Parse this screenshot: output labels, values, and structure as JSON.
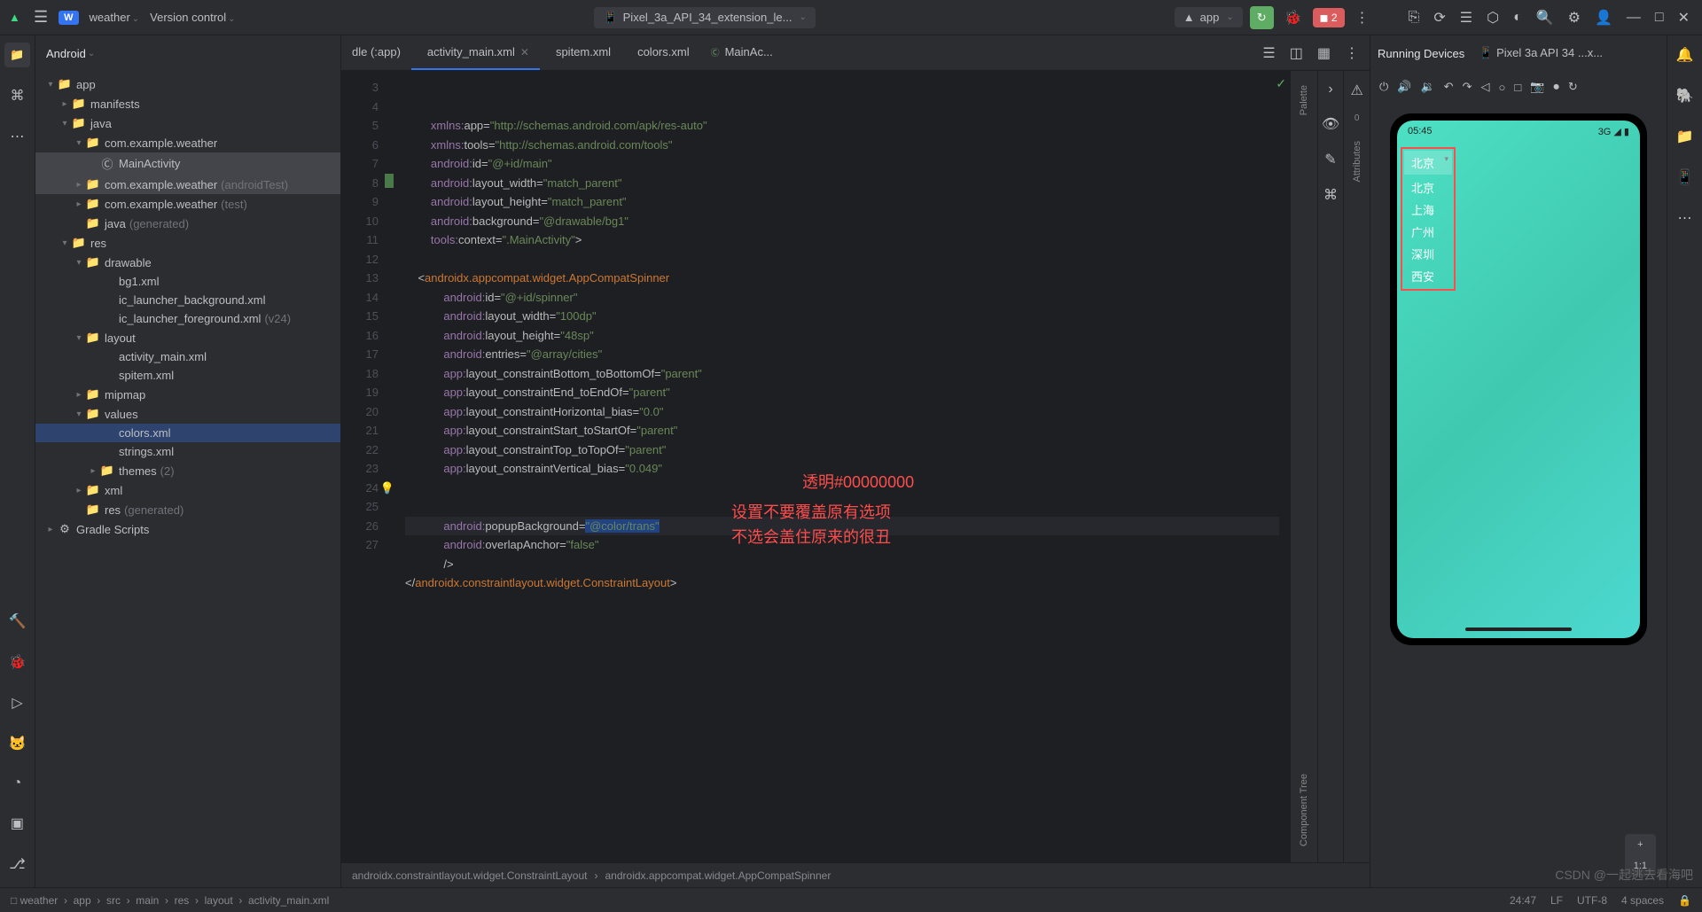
{
  "topBar": {
    "projectBadge": "W",
    "projectName": "weather",
    "versionControl": "Version control",
    "deviceConfig": "Pixel_3a_API_34_extension_le...",
    "runConfig": "app",
    "stopCount": "2"
  },
  "projectPanel": {
    "title": "Android",
    "tree": [
      {
        "indent": 0,
        "arrow": "▾",
        "icon": "📁",
        "label": "app",
        "cls": ""
      },
      {
        "indent": 1,
        "arrow": "▸",
        "icon": "📁",
        "label": "manifests",
        "cls": ""
      },
      {
        "indent": 1,
        "arrow": "▾",
        "icon": "📁",
        "label": "java",
        "cls": ""
      },
      {
        "indent": 2,
        "arrow": "▾",
        "icon": "📁",
        "label": "com.example.weather",
        "cls": ""
      },
      {
        "indent": 3,
        "arrow": "",
        "icon": "Ⓒ",
        "label": "MainActivity",
        "cls": "highlight"
      },
      {
        "indent": 2,
        "arrow": "▸",
        "icon": "📁",
        "label": "com.example.weather",
        "hint": "(androidTest)",
        "cls": "highlight"
      },
      {
        "indent": 2,
        "arrow": "▸",
        "icon": "📁",
        "label": "com.example.weather",
        "hint": "(test)",
        "cls": ""
      },
      {
        "indent": 2,
        "arrow": "",
        "icon": "📁",
        "label": "java",
        "hint": "(generated)",
        "cls": ""
      },
      {
        "indent": 1,
        "arrow": "▾",
        "icon": "📁",
        "label": "res",
        "cls": ""
      },
      {
        "indent": 2,
        "arrow": "▾",
        "icon": "📁",
        "label": "drawable",
        "cls": ""
      },
      {
        "indent": 3,
        "arrow": "",
        "icon": "</>",
        "label": "bg1.xml",
        "cls": ""
      },
      {
        "indent": 3,
        "arrow": "",
        "icon": "</>",
        "label": "ic_launcher_background.xml",
        "cls": ""
      },
      {
        "indent": 3,
        "arrow": "",
        "icon": "</>",
        "label": "ic_launcher_foreground.xml",
        "hint": "(v24)",
        "cls": ""
      },
      {
        "indent": 2,
        "arrow": "▾",
        "icon": "📁",
        "label": "layout",
        "cls": ""
      },
      {
        "indent": 3,
        "arrow": "",
        "icon": "</>",
        "label": "activity_main.xml",
        "cls": ""
      },
      {
        "indent": 3,
        "arrow": "",
        "icon": "</>",
        "label": "spitem.xml",
        "cls": ""
      },
      {
        "indent": 2,
        "arrow": "▸",
        "icon": "📁",
        "label": "mipmap",
        "cls": ""
      },
      {
        "indent": 2,
        "arrow": "▾",
        "icon": "📁",
        "label": "values",
        "cls": ""
      },
      {
        "indent": 3,
        "arrow": "",
        "icon": "</>",
        "label": "colors.xml",
        "cls": "selected"
      },
      {
        "indent": 3,
        "arrow": "",
        "icon": "</>",
        "label": "strings.xml",
        "cls": ""
      },
      {
        "indent": 3,
        "arrow": "▸",
        "icon": "📁",
        "label": "themes",
        "hint": "(2)",
        "cls": ""
      },
      {
        "indent": 2,
        "arrow": "▸",
        "icon": "📁",
        "label": "xml",
        "cls": ""
      },
      {
        "indent": 2,
        "arrow": "",
        "icon": "📁",
        "label": "res",
        "hint": "(generated)",
        "cls": ""
      },
      {
        "indent": 0,
        "arrow": "▸",
        "icon": "⚙",
        "label": "Gradle Scripts",
        "cls": ""
      }
    ]
  },
  "tabs": [
    {
      "icon": "",
      "label": "dle (:app)",
      "active": false,
      "close": false
    },
    {
      "icon": "</>",
      "label": "activity_main.xml",
      "active": true,
      "close": true
    },
    {
      "icon": "</>",
      "label": "spitem.xml",
      "active": false,
      "close": false
    },
    {
      "icon": "</>",
      "label": "colors.xml",
      "active": false,
      "close": false
    },
    {
      "icon": "Ⓒ",
      "label": "MainAc...",
      "active": false,
      "close": false
    }
  ],
  "code": {
    "startLine": 3,
    "lines": [
      "        <span class='c-ns'>xmlns:</span><span class='c-attr'>app</span>=<span class='c-str'>\"http://schemas.android.com/apk/res-auto\"</span>",
      "        <span class='c-ns'>xmlns:</span><span class='c-attr'>tools</span>=<span class='c-str'>\"http://schemas.android.com/tools\"</span>",
      "        <span class='c-ns'>android:</span><span class='c-attr'>id</span>=<span class='c-str'>\"@+id/main\"</span>",
      "        <span class='c-ns'>android:</span><span class='c-attr'>layout_width</span>=<span class='c-str'>\"match_parent\"</span>",
      "        <span class='c-ns'>android:</span><span class='c-attr'>layout_height</span>=<span class='c-str'>\"match_parent\"</span>",
      "        <span class='c-ns'>android:</span><span class='c-attr'>background</span>=<span class='c-str'>\"@drawable/bg1\"</span>",
      "        <span class='c-ns'>tools:</span><span class='c-attr'>context</span>=<span class='c-str'>\".MainActivity\"</span>&gt;",
      "",
      "    &lt;<span class='c-tag'>androidx.appcompat.widget.AppCompatSpinner</span>",
      "            <span class='c-ns'>android:</span><span class='c-attr'>id</span>=<span class='c-str'>\"@+id/spinner\"</span>",
      "            <span class='c-ns'>android:</span><span class='c-attr'>layout_width</span>=<span class='c-str'>\"100dp\"</span>",
      "            <span class='c-ns'>android:</span><span class='c-attr'>layout_height</span>=<span class='c-str'>\"48sp\"</span>",
      "            <span class='c-ns'>android:</span><span class='c-attr'>entries</span>=<span class='c-str'>\"@array/cities\"</span>",
      "            <span class='c-ns'>app:</span><span class='c-attr'>layout_constraintBottom_toBottomOf</span>=<span class='c-str'>\"parent\"</span>",
      "            <span class='c-ns'>app:</span><span class='c-attr'>layout_constraintEnd_toEndOf</span>=<span class='c-str'>\"parent\"</span>",
      "            <span class='c-ns'>app:</span><span class='c-attr'>layout_constraintHorizontal_bias</span>=<span class='c-str'>\"0.0\"</span>",
      "            <span class='c-ns'>app:</span><span class='c-attr'>layout_constraintStart_toStartOf</span>=<span class='c-str'>\"parent\"</span>",
      "            <span class='c-ns'>app:</span><span class='c-attr'>layout_constraintTop_toTopOf</span>=<span class='c-str'>\"parent\"</span>",
      "            <span class='c-ns'>app:</span><span class='c-attr'>layout_constraintVertical_bias</span>=<span class='c-str'>\"0.049\"</span>",
      "",
      "",
      "            <span class='c-ns'>android:</span><span class='c-attr'>popupBackground</span>=<span class='c-str c-sel'>\"@color/trans\"</span>",
      "            <span class='c-ns'>android:</span><span class='c-attr'>overlapAnchor</span>=<span class='c-str'>\"false\"</span>",
      "            /&gt;",
      "&lt;/<span class='c-tag'>androidx.constraintlayout.widget.ConstraintLayout</span>&gt;"
    ],
    "annotations": {
      "a1": "透明#00000000",
      "a2": "设置不要覆盖原有选项",
      "a3": "不选会盖住原来的很丑"
    }
  },
  "editorFooter": {
    "crumb1": "androidx.constraintlayout.widget.ConstraintLayout",
    "crumb2": "androidx.appcompat.widget.AppCompatSpinner"
  },
  "palette": {
    "label1": "Palette",
    "label2": "Attributes",
    "label3": "Component Tree"
  },
  "devicePanel": {
    "tab1": "Running Devices",
    "tab2": "Pixel 3a API 34 ...x...",
    "statusTime": "05:45",
    "statusSignal": "3G ◢ ▮",
    "spinnerSelected": "北京",
    "spinnerItems": [
      "北京",
      "上海",
      "广州",
      "深圳",
      "西安"
    ],
    "zoomPlus": "+",
    "zoomRatio": "1:1"
  },
  "statusBar": {
    "crumbs": [
      "weather",
      "app",
      "src",
      "main",
      "res",
      "layout",
      "activity_main.xml"
    ],
    "cursor": "24:47",
    "lineEnd": "LF",
    "encoding": "UTF-8",
    "spaces": "4 spaces"
  },
  "watermark": "CSDN @一起逃去看海吧"
}
